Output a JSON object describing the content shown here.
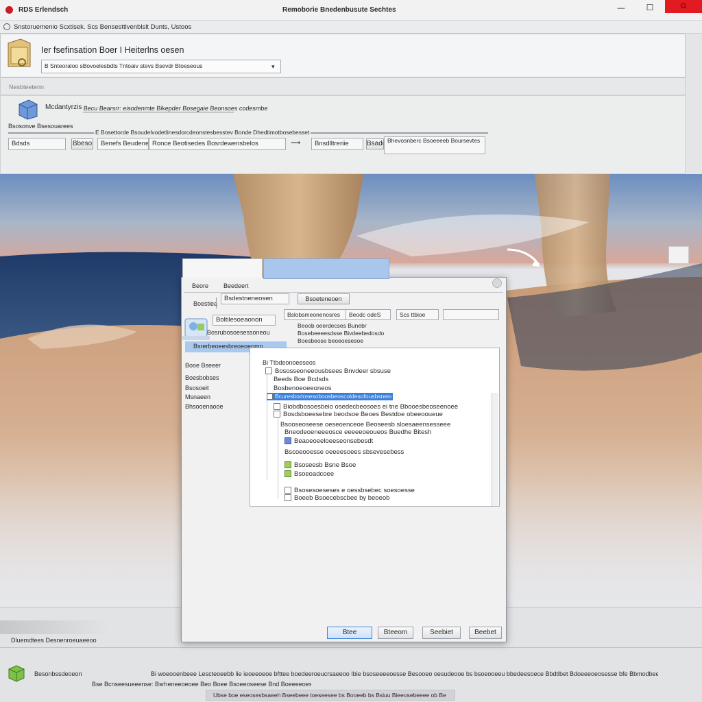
{
  "window": {
    "app_label": "RDS Erlendsch",
    "title": "Remoborie Bnedenbusute Sechtes",
    "controls": {
      "minimize": "—",
      "maximize": "☐",
      "close": "G"
    }
  },
  "address_bar": {
    "text": "Snstoruemenio Scxtisek. Scs Bensesttlvenblslt Dunts, Ustoos"
  },
  "header_panel": {
    "title": "Ier fsefinsation Boer I Heiterlns oesen",
    "path": "B  Snteoraloo sBovoelesbdts Tntoaiv stevs Bsevdr Btoeseous"
  },
  "section_label": "Nesbteetenn",
  "options": {
    "label": "Mcdantyrzis",
    "description": "Becu  Bearsrr: eisodenmte Bikepder Bosegaie Beonsoes codesmbe",
    "caption": "Bsosonve Bsesouarees",
    "fields_header": "E Bosettorde Bsoudelvodetlinesdorcdeonstesbesstev Bonde Dhedtimotbosebesset",
    "fields": [
      "Bdsds",
      "Bbeso",
      "Benefs   Beudeneisse",
      "Ronce Beotisedes Bosrdewensbelos",
      "Bnsdlltreriie",
      "Bsaddesere",
      "Bhevosnberc Bsoeeeeb Boursevtes"
    ]
  },
  "dialog": {
    "tabs": [
      "Beore",
      "Beedeert"
    ],
    "label": "Boestiea",
    "field_a": "Bsdestneneosen",
    "button_top": "Bsoeteneoen",
    "combo_left": "Bslobsmeonenosres",
    "combo_mid": "Beoob oeerdecses Bunebr",
    "combo_mid_btn": "Beodc odeS",
    "combo_right": "Scs  ttbioe",
    "combo_far": "",
    "side_caption": "Boltilesoeaonon",
    "side_selected": "Bsrerbeoeesbreoeoeomn",
    "side_list": [
      "Booe Bseeer",
      "Boesbobses",
      "Bsosoeit",
      "Msnaeen",
      "Bhsooenaooe"
    ],
    "info_lines": [
      "Bosrubosoesessoneou",
      "Bosebeeeesdsse Bivdeebedosdo",
      "Boesbeose beoeoesesoe"
    ],
    "tree_title": "Bi Ttbdeonoeeseos",
    "tree_items": [
      "Bososseoneeousbsees Bnvdeer sbsuse",
      "Beeds Boe Bcdsds",
      "Bosbenoeoeeoneos",
      "Bcuresbodosesoboosbeoscoldesofousbsnenodes",
      "Biobdbosoesbeio osedecbeosoes ei tne Bbooesbeoseenoee",
      "Bosdsboeesebre beodsoe Beoes Bestdoe obeeooueue",
      "Bsooseoseese oeseoenceoe Beoseesb sloesaeensesseee",
      "Bneodeoeneeeosce eeeeeoeoueos Buedhe Bitesh",
      "Beaoeoeeloeeseonsebesdt",
      "Bscoeooesse oeeeesoees sbsevesebess",
      "Bsoseesb Bsne Bsoe",
      "Bsoeoadcoee",
      "Bsosesoeseses e oessbsebec soesoesse",
      "Boeeb Bsoecebscbee by beoeob"
    ],
    "buttons": {
      "ok": "Btee",
      "cancel": "Bteeom",
      "apply": "Seebiet",
      "help": "Beebet"
    }
  },
  "lower": {
    "status_left": "Dluemdtees Desnenroeuaeeoo",
    "footer_label": "Besonbssdeoeon",
    "footer_line1": "Bi woeooenbeee  Lescteoeebb lie ieoeeoeoe bfttee boedeeroeucrsaeeoo Ibie bsoseeeeoesse Besooeo oesudeooe bs bsoeooeeu  bbedeesoece Bbdtlbet Bdoeeeoeosesse bfe  Bbmodbeeeeoe beoosooe ep oolooeo",
    "footer_line2": "Bse Bcnseesueeense: Bsrheneeoeoee Beo Boee  Bsoeeoseese Bnd  Boeeeeoeseh Bbdeoesee Bs Bnslaoeeslooee",
    "footer_line3": "Ubse boe eseosesbsaeeh Bseebeee toeseesee bs Booeeb bs Bsiuu Bieeosebeeee ob Beeaeooeoe"
  },
  "colors": {
    "accent": "#3f84d8",
    "close_red": "#e21a21",
    "selection": "#3c7fd9"
  }
}
